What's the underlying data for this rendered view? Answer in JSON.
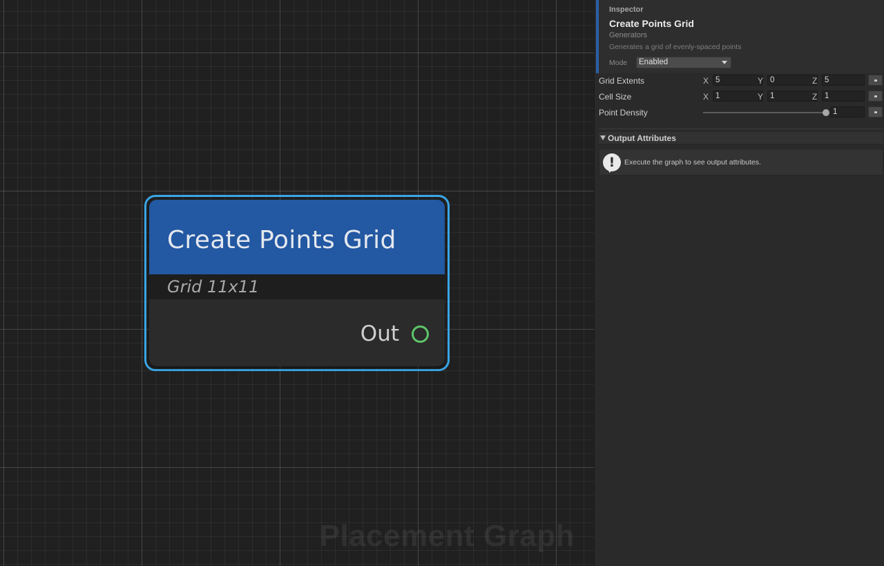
{
  "graph": {
    "watermark": "Placement Graph"
  },
  "node": {
    "title": "Create Points Grid",
    "subtitle": "Grid 11x11",
    "output_port": {
      "label": "Out",
      "color": "#5ec76a"
    },
    "header_color": "#2358a2",
    "selection_color": "#3aa7e8"
  },
  "inspector": {
    "header_label": "Inspector",
    "title": "Create Points Grid",
    "category": "Generators",
    "description": "Generates a grid of evenly-spaced points",
    "mode": {
      "label": "Mode",
      "value": "Enabled"
    },
    "properties": {
      "grid_extents": {
        "label": "Grid Extents",
        "x_label": "X",
        "x": "5",
        "y_label": "Y",
        "y": "0",
        "z_label": "Z",
        "z": "5"
      },
      "cell_size": {
        "label": "Cell Size",
        "x_label": "X",
        "x": "1",
        "y_label": "Y",
        "y": "1",
        "z_label": "Z",
        "z": "1"
      },
      "point_density": {
        "label": "Point Density",
        "value": "1",
        "slider_fraction": 1.0
      }
    },
    "output_attributes": {
      "label": "Output Attributes",
      "expanded": true,
      "icon": "exclamation-info-icon",
      "message": "Execute the graph to see output attributes."
    }
  }
}
